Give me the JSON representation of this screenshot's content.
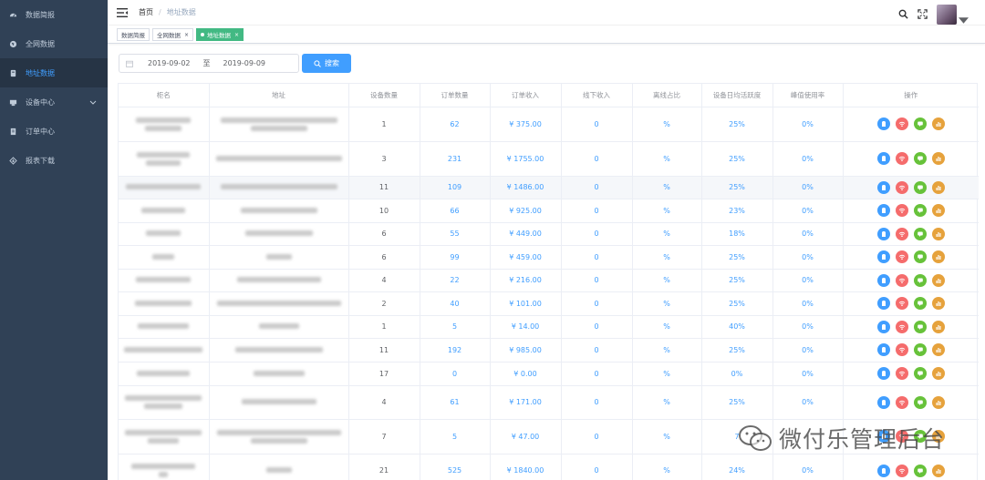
{
  "sidebar": {
    "items": [
      {
        "label": "数据简报",
        "icon": "dashboard-icon"
      },
      {
        "label": "全网数据",
        "icon": "globe-icon"
      },
      {
        "label": "地址数据",
        "icon": "location-icon",
        "active": true
      },
      {
        "label": "设备中心",
        "icon": "device-icon",
        "expandable": true
      },
      {
        "label": "订单中心",
        "icon": "order-icon"
      },
      {
        "label": "报表下载",
        "icon": "download-icon"
      }
    ]
  },
  "breadcrumb": {
    "home": "首页",
    "separator": "/",
    "current": "地址数据"
  },
  "tags": [
    {
      "label": "数据简报",
      "closable": false
    },
    {
      "label": "全网数据",
      "closable": true
    },
    {
      "label": "地址数据",
      "closable": true,
      "active": true
    }
  ],
  "filter": {
    "start_date": "2019-09-02",
    "to_label": "至",
    "end_date": "2019-09-09",
    "search_label": "搜索"
  },
  "table": {
    "columns": [
      "柜名",
      "地址",
      "设备数量",
      "订单数量",
      "订单收入",
      "线下收入",
      "离线占比",
      "设备日均活跃度",
      "峰值使用率",
      "操作"
    ],
    "rows": [
      {
        "qty": "1",
        "orders": "62",
        "income": "¥ 375.00",
        "offline": "0",
        "ratio": "%",
        "active": "25%",
        "peak": "0%"
      },
      {
        "qty": "3",
        "orders": "231",
        "income": "¥ 1755.00",
        "offline": "0",
        "ratio": "%",
        "active": "25%",
        "peak": "0%"
      },
      {
        "qty": "11",
        "orders": "109",
        "income": "¥ 1486.00",
        "offline": "0",
        "ratio": "%",
        "active": "25%",
        "peak": "0%"
      },
      {
        "qty": "10",
        "orders": "66",
        "income": "¥ 925.00",
        "offline": "0",
        "ratio": "%",
        "active": "23%",
        "peak": "0%"
      },
      {
        "qty": "6",
        "orders": "55",
        "income": "¥ 449.00",
        "offline": "0",
        "ratio": "%",
        "active": "18%",
        "peak": "0%"
      },
      {
        "qty": "6",
        "orders": "99",
        "income": "¥ 459.00",
        "offline": "0",
        "ratio": "%",
        "active": "25%",
        "peak": "0%"
      },
      {
        "qty": "4",
        "orders": "22",
        "income": "¥ 216.00",
        "offline": "0",
        "ratio": "%",
        "active": "25%",
        "peak": "0%"
      },
      {
        "qty": "2",
        "orders": "40",
        "income": "¥ 101.00",
        "offline": "0",
        "ratio": "%",
        "active": "25%",
        "peak": "0%"
      },
      {
        "qty": "1",
        "orders": "5",
        "income": "¥ 14.00",
        "offline": "0",
        "ratio": "%",
        "active": "40%",
        "peak": "0%"
      },
      {
        "qty": "11",
        "orders": "192",
        "income": "¥ 985.00",
        "offline": "0",
        "ratio": "%",
        "active": "25%",
        "peak": "0%"
      },
      {
        "qty": "17",
        "orders": "0",
        "income": "¥ 0.00",
        "offline": "0",
        "ratio": "%",
        "active": "0%",
        "peak": "0%"
      },
      {
        "qty": "4",
        "orders": "61",
        "income": "¥ 171.00",
        "offline": "0",
        "ratio": "%",
        "active": "25%",
        "peak": "0%"
      },
      {
        "qty": "7",
        "orders": "5",
        "income": "¥ 47.00",
        "offline": "0",
        "ratio": "%",
        "active": "7",
        "peak": ""
      },
      {
        "qty": "21",
        "orders": "525",
        "income": "¥ 1840.00",
        "offline": "0",
        "ratio": "%",
        "active": "24%",
        "peak": "0%"
      }
    ],
    "operations": [
      {
        "icon": "clipboard-icon",
        "color": "#409eff"
      },
      {
        "icon": "wifi-icon",
        "color": "#f56c6c"
      },
      {
        "icon": "chat-icon",
        "color": "#67c23a"
      },
      {
        "icon": "chart-icon",
        "color": "#e6a23c"
      }
    ]
  },
  "watermark": {
    "text": "微付乐管理后台"
  }
}
